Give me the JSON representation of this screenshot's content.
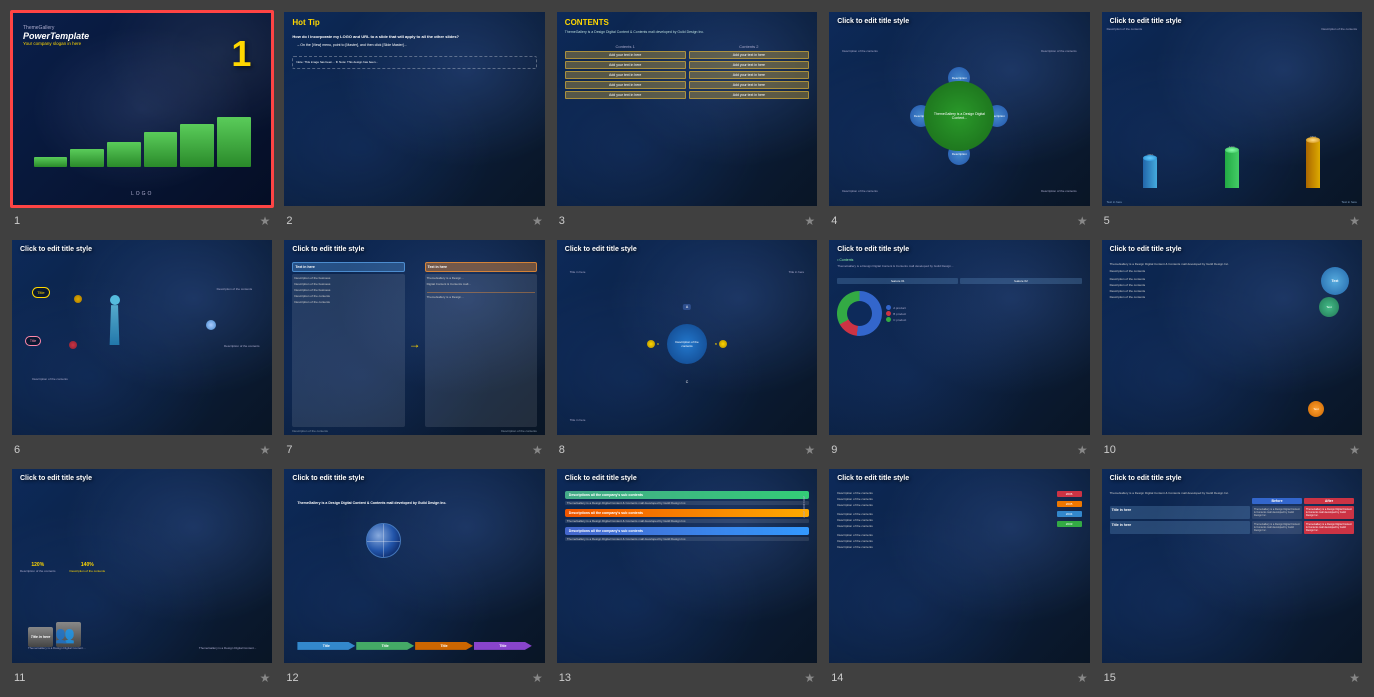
{
  "slides": [
    {
      "id": 1,
      "num": "1",
      "type": "cover",
      "selected": true,
      "title": "PowerTemplate",
      "subtitle": "ThemeGallery",
      "slogan": "Your company slogan in here",
      "logo": "LOGO"
    },
    {
      "id": 2,
      "num": "2",
      "type": "hot-tip",
      "title": "Hot Tip",
      "content": "How do I incorporate my LOGO and URL to a slide that will apply to all the other slides?"
    },
    {
      "id": 3,
      "num": "3",
      "type": "contents",
      "title": "CONTENTS",
      "col1": "Contents 1",
      "col2": "Contents 2"
    },
    {
      "id": 4,
      "num": "4",
      "type": "diagram",
      "title": "Click to edit title style"
    },
    {
      "id": 5,
      "num": "5",
      "type": "diagram",
      "title": "Click to edit title style"
    },
    {
      "id": 6,
      "num": "6",
      "type": "diagram",
      "title": "Click to edit title style"
    },
    {
      "id": 7,
      "num": "7",
      "type": "diagram",
      "title": "Click to edit title style"
    },
    {
      "id": 8,
      "num": "8",
      "type": "diagram",
      "title": "Click to edit title style"
    },
    {
      "id": 9,
      "num": "9",
      "type": "diagram",
      "title": "Click to edit title style"
    },
    {
      "id": 10,
      "num": "10",
      "type": "diagram",
      "title": "Click to edit title style"
    },
    {
      "id": 11,
      "num": "11",
      "type": "diagram",
      "title": "Click to edit title style"
    },
    {
      "id": 12,
      "num": "12",
      "type": "diagram",
      "title": "Click to edit title style"
    },
    {
      "id": 13,
      "num": "13",
      "type": "diagram",
      "title": "Click to edit title style"
    },
    {
      "id": 14,
      "num": "14",
      "type": "diagram",
      "title": "Click to edit title style"
    },
    {
      "id": 15,
      "num": "15",
      "type": "diagram",
      "title": "Click to edit title style"
    }
  ],
  "star_icon": "★",
  "colors": {
    "selected_border": "#ff3333",
    "title_yellow": "#ffd700",
    "blue_dark": "#0d2a5a",
    "green": "#4aaa4a",
    "orange": "#ff8800",
    "pink": "#ee44aa",
    "teal": "#00bbcc",
    "purple": "#8844cc",
    "red": "#dd2222",
    "cyan": "#00ccee"
  }
}
